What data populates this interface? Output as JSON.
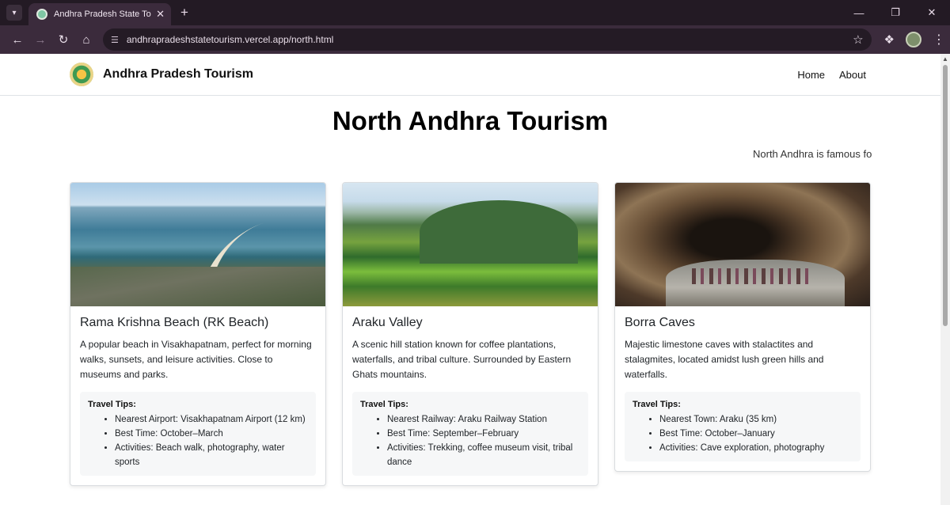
{
  "browser": {
    "tab_title": "Andhra Pradesh State Tourism",
    "url": "andhrapradeshstatetourism.vercel.app/north.html",
    "icons": {
      "tab_menu": "chevron-down-icon",
      "close": "close-icon",
      "new_tab": "plus-icon",
      "back": "arrow-left-icon",
      "forward": "arrow-right-icon",
      "reload": "reload-icon",
      "home": "home-icon",
      "site_info": "tune-icon",
      "bookmark": "star-icon",
      "extensions": "puzzle-icon",
      "menu": "kebab-icon"
    }
  },
  "site": {
    "brand": "Andhra Pradesh Tourism",
    "nav": [
      {
        "label": "Home"
      },
      {
        "label": "About"
      }
    ]
  },
  "page": {
    "title": "North Andhra Tourism",
    "marquee": "North Andhra is famous fo"
  },
  "cards": [
    {
      "title": "Rama Krishna Beach (RK Beach)",
      "text": "A popular beach in Visakhapatnam, perfect for morning walks, sunsets, and leisure activities. Close to museums and parks.",
      "tips_title": "Travel Tips:",
      "tips": [
        "Nearest Airport: Visakhapatnam Airport (12 km)",
        "Best Time: October–March",
        "Activities: Beach walk, photography, water sports"
      ]
    },
    {
      "title": "Araku Valley",
      "text": "A scenic hill station known for coffee plantations, waterfalls, and tribal culture. Surrounded by Eastern Ghats mountains.",
      "tips_title": "Travel Tips:",
      "tips": [
        "Nearest Railway: Araku Railway Station",
        "Best Time: September–February",
        "Activities: Trekking, coffee museum visit, tribal dance"
      ]
    },
    {
      "title": "Borra Caves",
      "text": "Majestic limestone caves with stalactites and stalagmites, located amidst lush green hills and waterfalls.",
      "tips_title": "Travel Tips:",
      "tips": [
        "Nearest Town: Araku (35 km)",
        "Best Time: October–January",
        "Activities: Cave exploration, photography"
      ]
    }
  ]
}
